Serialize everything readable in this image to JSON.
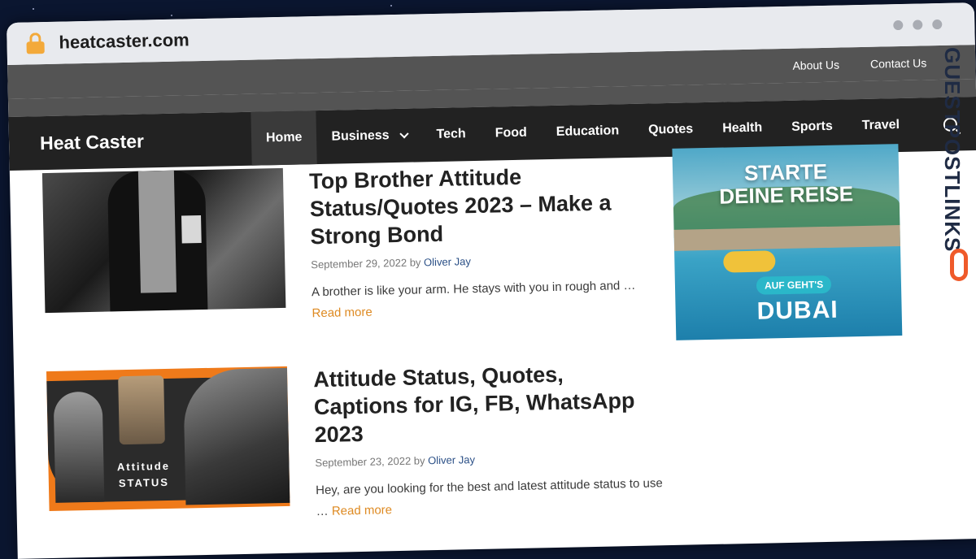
{
  "browser": {
    "url": "heatcaster.com"
  },
  "topbar": {
    "links": [
      "About Us",
      "Contact Us"
    ]
  },
  "header": {
    "site_title": "Heat Caster"
  },
  "nav": {
    "items": [
      "Home",
      "Business",
      "Tech",
      "Food",
      "Education",
      "Quotes",
      "Health",
      "Sports",
      "Travel"
    ],
    "active": "Home"
  },
  "posts": [
    {
      "title": "Top Brother Attitude Status/Quotes 2023 – Make a Strong Bond",
      "date": "September 29, 2022",
      "by": "by",
      "author": "Oliver Jay",
      "excerpt": "A brother is like your arm. He stays with you in rough and …",
      "read_more": "Read more"
    },
    {
      "title": "Attitude Status, Quotes, Captions for IG, FB, WhatsApp 2023",
      "date": "September 23, 2022",
      "by": "by",
      "author": "Oliver Jay",
      "excerpt": "Hey, are you looking for the best and latest attitude status to use …",
      "read_more": "Read more",
      "thumb_caption_1": "Attitude",
      "thumb_caption_2": "STATUS"
    }
  ],
  "ad": {
    "headline_1": "STARTE",
    "headline_2": "DEINE REISE",
    "cta": "AUF GEHT'S",
    "city": "DUBAI"
  },
  "watermark": {
    "text": "GUESTPOSTLINKS"
  },
  "colors": {
    "topbar": "#545454",
    "navbar": "#222222",
    "accent_link": "#de8a22",
    "author_link": "#2a4f86",
    "lock": "#f3a93a"
  }
}
